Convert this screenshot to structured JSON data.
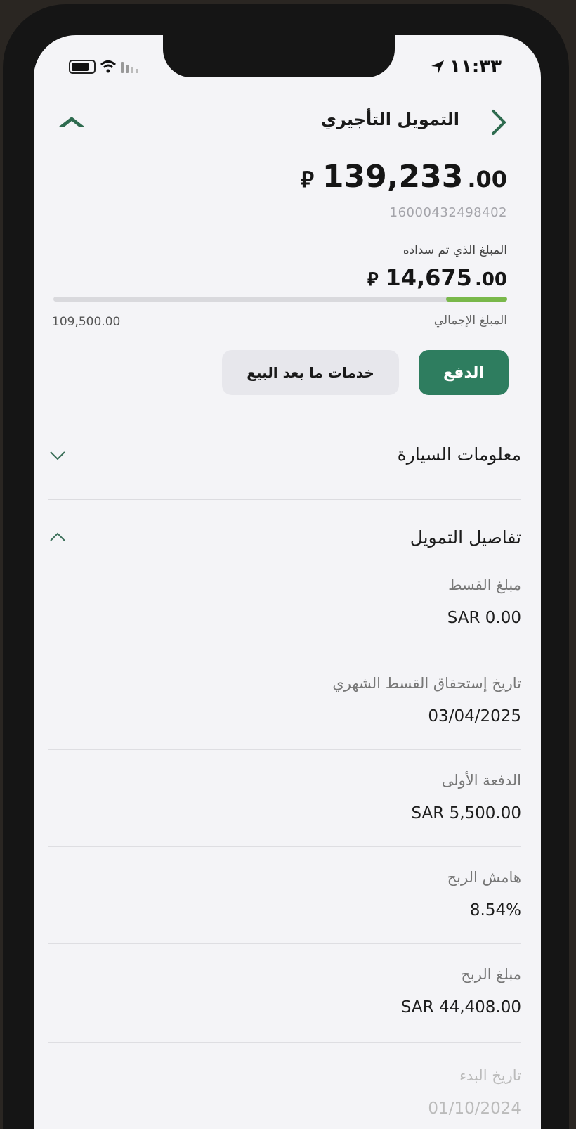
{
  "status_bar": {
    "time": "١١:٣٣"
  },
  "header": {
    "title": "التمويل التأجيري"
  },
  "summary": {
    "amount_int": "139,233",
    "amount_dec": ".00",
    "currency_symbol": "⃁",
    "account_number": "16000432498402",
    "paid_label": "المبلغ الذي تم سداده",
    "paid_int": "14,675",
    "paid_dec": ".00",
    "progress_percent": 13.4,
    "total_label": "المبلغ الإجمالي",
    "total_value": "109,500.00"
  },
  "actions": {
    "pay_label": "الدفع",
    "after_sales_label": "خدمات ما بعد البيع"
  },
  "sections": {
    "car_info": "معلومات السيارة",
    "financing_details": "تفاصيل التمويل"
  },
  "details": [
    {
      "label": "مبلغ القسط",
      "value": "SAR 0.00"
    },
    {
      "label": "تاريخ إستحقاق القسط الشهري",
      "value": "03/04/2025"
    },
    {
      "label": "الدفعة الأولى",
      "value": "SAR 5,500.00"
    },
    {
      "label": "هامش الربح",
      "value": "8.54%"
    },
    {
      "label": "مبلغ الربح",
      "value": "SAR 44,408.00"
    },
    {
      "label": "تاريخ البدء",
      "value": "01/10/2024"
    }
  ],
  "colors": {
    "accent": "#2e7d5f",
    "progress": "#79b84a"
  }
}
